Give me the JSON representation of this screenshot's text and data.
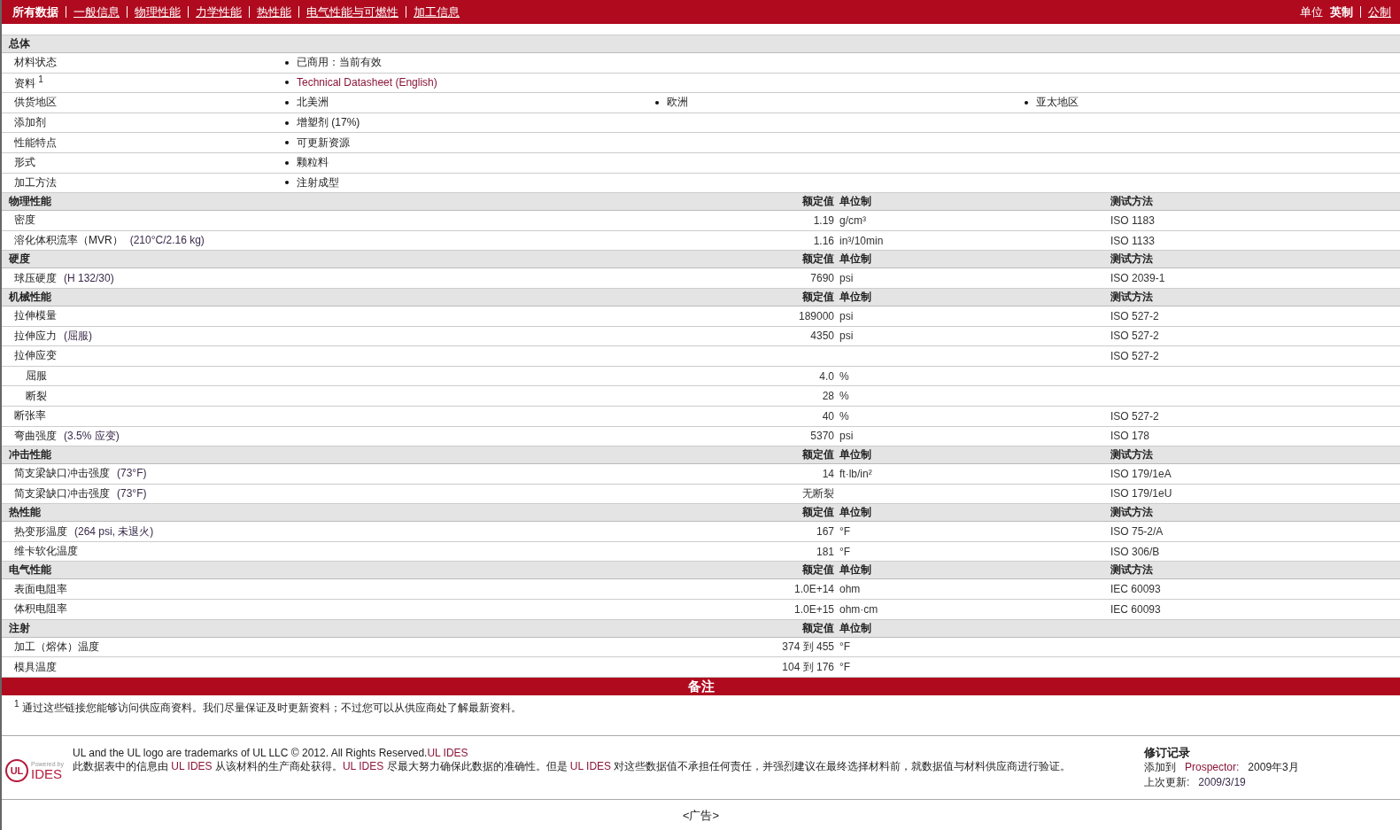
{
  "nav": {
    "tabs": [
      {
        "label": "所有数据",
        "selected": true
      },
      {
        "label": "一般信息",
        "selected": false
      },
      {
        "label": "物理性能",
        "selected": false
      },
      {
        "label": "力学性能",
        "selected": false
      },
      {
        "label": "热性能",
        "selected": false
      },
      {
        "label": "电气性能与可燃性",
        "selected": false
      },
      {
        "label": "加工信息",
        "selected": false
      }
    ],
    "units": {
      "label": "单位",
      "options": [
        {
          "label": "英制",
          "selected": true
        },
        {
          "label": "公制",
          "selected": false
        }
      ]
    }
  },
  "general": {
    "title": "总体",
    "rows": [
      {
        "label": "材料状态",
        "values": [
          {
            "text": "已商用：当前有效",
            "kind": "text"
          }
        ]
      },
      {
        "label": "资料 $^{1}$",
        "values": [
          {
            "text": "Technical Datasheet (English)",
            "kind": "link"
          }
        ]
      },
      {
        "label": "供货地区",
        "values": [
          {
            "text": "北美洲",
            "kind": "text"
          },
          {
            "text": "欧洲",
            "kind": "text"
          },
          {
            "text": "亚太地区",
            "kind": "text"
          }
        ]
      },
      {
        "label": "添加剂",
        "values": [
          {
            "text": "增塑剂 (17%)",
            "kind": "text"
          }
        ]
      },
      {
        "label": "性能特点",
        "values": [
          {
            "text": "可更新资源",
            "kind": "text"
          }
        ]
      },
      {
        "label": "形式",
        "values": [
          {
            "text": "颗粒料",
            "kind": "text"
          }
        ]
      },
      {
        "label": "加工方法",
        "values": [
          {
            "text": "注射成型",
            "kind": "text"
          }
        ]
      }
    ]
  },
  "sections": [
    {
      "title": "物理性能",
      "headers": {
        "value": "额定值",
        "unit": "单位制",
        "method": "测试方法"
      },
      "rows": [
        {
          "label": "密度",
          "value": "1.19",
          "unit": "g/cm³",
          "method": "ISO 1183"
        },
        {
          "label": "溶化体积流率（MVR）",
          "condition": "(210°C/2.16 kg)",
          "value": "1.16",
          "unit": "in³/10min",
          "method": "ISO 1133"
        }
      ]
    },
    {
      "title": "硬度",
      "headers": {
        "value": "额定值",
        "unit": "单位制",
        "method": "测试方法"
      },
      "rows": [
        {
          "label": "球压硬度",
          "condition": "(H 132/30)",
          "value": "7690",
          "unit": "psi",
          "method": "ISO 2039-1"
        }
      ]
    },
    {
      "title": "机械性能",
      "headers": {
        "value": "额定值",
        "unit": "单位制",
        "method": "测试方法"
      },
      "rows": [
        {
          "label": "拉伸模量",
          "value": "189000",
          "unit": "psi",
          "method": "ISO 527-2"
        },
        {
          "label": "拉伸应力",
          "condition": "(屈服)",
          "value": "4350",
          "unit": "psi",
          "method": "ISO 527-2"
        },
        {
          "label": "拉伸应变",
          "method": "ISO 527-2",
          "children": [
            {
              "label": "屈服",
              "value": "4.0",
              "unit": "%"
            },
            {
              "label": "断裂",
              "value": "28",
              "unit": "%"
            }
          ]
        },
        {
          "label": "断张率",
          "value": "40",
          "unit": "%",
          "method": "ISO 527-2"
        },
        {
          "label": "弯曲强度",
          "condition": "(3.5% 应变)",
          "value": "5370",
          "unit": "psi",
          "method": "ISO 178"
        }
      ]
    },
    {
      "title": "冲击性能",
      "headers": {
        "value": "额定值",
        "unit": "单位制",
        "method": "测试方法"
      },
      "rows": [
        {
          "label": "简支梁缺口冲击强度",
          "condition": "(73°F)",
          "value": "14",
          "unit": "ft·lb/in²",
          "method": "ISO 179/1eA"
        },
        {
          "label": "简支梁缺口冲击强度",
          "condition": "(73°F)",
          "value": "无断裂",
          "method": "ISO 179/1eU"
        }
      ]
    },
    {
      "title": "热性能",
      "headers": {
        "value": "额定值",
        "unit": "单位制",
        "method": "测试方法"
      },
      "rows": [
        {
          "label": "热变形温度",
          "condition": "(264 psi, 未退火)",
          "value": "167",
          "unit": "°F",
          "method": "ISO 75-2/A"
        },
        {
          "label": "维卡软化温度",
          "value": "181",
          "unit": "°F",
          "method": "ISO 306/B"
        }
      ]
    },
    {
      "title": "电气性能",
      "headers": {
        "value": "额定值",
        "unit": "单位制",
        "method": "测试方法"
      },
      "rows": [
        {
          "label": "表面电阻率",
          "value": "1.0E+14",
          "unit": "ohm",
          "method": "IEC 60093"
        },
        {
          "label": "体积电阻率",
          "value": "1.0E+15",
          "unit": "ohm·cm",
          "method": "IEC 60093"
        }
      ]
    },
    {
      "title": "注射",
      "headers": {
        "value": "额定值",
        "unit": "单位制"
      },
      "rows": [
        {
          "label": "加工（熔体）温度",
          "value": "374 到 455",
          "unit": "°F"
        },
        {
          "label": "模具温度",
          "value": "104 到 176",
          "unit": "°F"
        }
      ]
    }
  ],
  "notes": {
    "title": "备注",
    "footnote": "$^{1}$ 通过这些链接您能够访问供应商资料。我们尽量保证及时更新资料；不过您可以从供应商处了解最新资料。"
  },
  "footer": {
    "logo": {
      "mark": "UL",
      "powered": "Powered by",
      "brand": "IDES"
    },
    "trademark": [
      {
        "text": "UL and the UL logo are trademarks of UL LLC © 2012. All Rights Reserved.",
        "kind": "text"
      },
      {
        "text": "UL IDES",
        "kind": "link"
      }
    ],
    "disclaimer": [
      {
        "text": "此数据表中的信息由 ",
        "kind": "text"
      },
      {
        "text": "UL IDES",
        "kind": "link"
      },
      {
        "text": " 从该材料的生产商处获得。",
        "kind": "text"
      },
      {
        "text": "UL IDES",
        "kind": "link"
      },
      {
        "text": " 尽最大努力确保此数据的准确性。但是 ",
        "kind": "text"
      },
      {
        "text": "UL IDES",
        "kind": "link"
      },
      {
        "text": " 对这些数据值不承担任何责任，并强烈建议在最终选择材料前，就数据值与材料供应商进行验证。",
        "kind": "text"
      }
    ],
    "revision": {
      "title": "修订记录",
      "added_label": "添加到",
      "added_source": "Prospector:",
      "added_date": "2009年3月",
      "updated_label": "上次更新:",
      "updated_date": "2009/3/19"
    }
  },
  "ad": "<广告>"
}
